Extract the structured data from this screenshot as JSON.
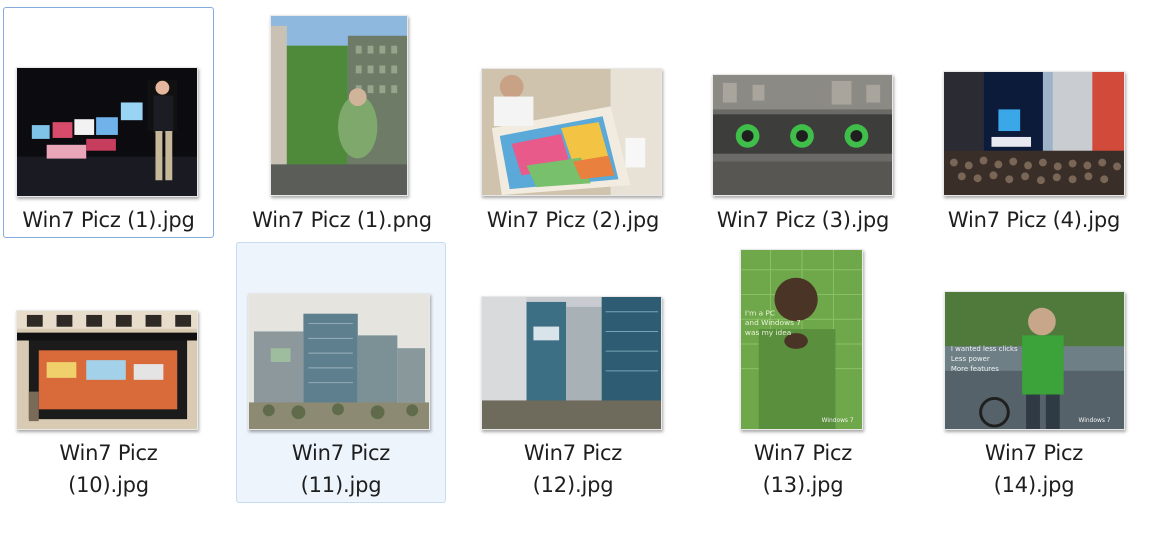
{
  "files": [
    {
      "name": "Win7 Picz (1).jpg",
      "line1": "Win7 Picz (1).jpg",
      "line2": "",
      "state": "focused",
      "image": "presenter-with-laptops-photo"
    },
    {
      "name": "Win7 Picz (1).png",
      "line1": "Win7 Picz (1).png",
      "line2": "",
      "state": "normal",
      "image": "building-billboard-photo"
    },
    {
      "name": "Win7 Picz (2).jpg",
      "line1": "Win7 Picz (2).jpg",
      "line2": "",
      "state": "normal",
      "image": "painting-mural-photo"
    },
    {
      "name": "Win7 Picz (3).jpg",
      "line1": "Win7 Picz (3).jpg",
      "line2": "",
      "state": "normal",
      "image": "aerial-plaza-photo"
    },
    {
      "name": "Win7 Picz (4).jpg",
      "line1": "Win7 Picz (4).jpg",
      "line2": "",
      "state": "normal",
      "image": "times-square-crowd-photo"
    },
    {
      "name": "Win7 Picz (10).jpg",
      "line1": "Win7 Picz",
      "line2": "(10).jpg",
      "state": "normal",
      "image": "storefront-photo"
    },
    {
      "name": "Win7 Picz (11).jpg",
      "line1": "Win7 Picz",
      "line2": "(11).jpg",
      "state": "hovered",
      "image": "office-towers-photo"
    },
    {
      "name": "Win7 Picz (12).jpg",
      "line1": "Win7 Picz",
      "line2": "(12).jpg",
      "state": "normal",
      "image": "glass-buildings-photo"
    },
    {
      "name": "Win7 Picz (13).jpg",
      "line1": "Win7 Picz",
      "line2": "(13).jpg",
      "state": "normal",
      "image": "man-green-poster-photo"
    },
    {
      "name": "Win7 Picz (14).jpg",
      "line1": "Win7 Picz",
      "line2": "(14).jpg",
      "state": "normal",
      "image": "cyclist-poster-photo"
    }
  ],
  "poster_texts": {
    "p13": [
      "I'm a PC",
      "and Windows 7",
      "was my idea"
    ],
    "p14": [
      "I wanted less clicks",
      "Less power",
      "More features"
    ],
    "brand": "Windows 7"
  }
}
